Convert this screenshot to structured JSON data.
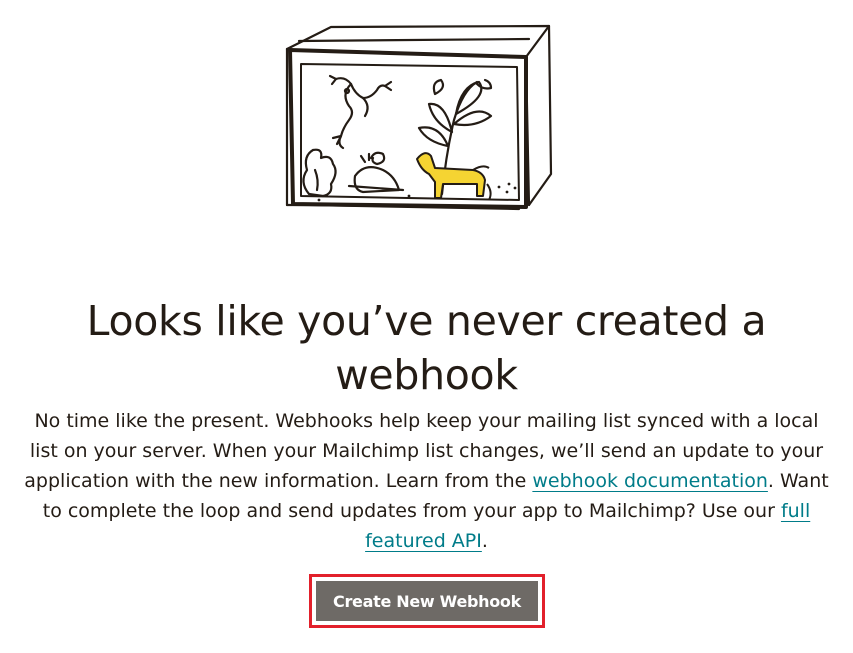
{
  "empty_state": {
    "illustration_icon": "terrarium-illustration",
    "headline": "Looks like you’ve never created a webhook",
    "body": {
      "text_1": "No time like the present. Webhooks help keep your mailing list synced with a local list on your server. When your Mailchimp list changes, we’ll send an update to your application with the new information. Learn from the ",
      "link_1": "webhook documentation",
      "text_2": ". Want to complete the loop and send updates from your app to Mailchimp? Use our ",
      "link_2": "full featured API",
      "text_3": "."
    },
    "cta_label": "Create New Webhook"
  },
  "colors": {
    "text": "#241c15",
    "link": "#007c89",
    "button": "#6e6a66",
    "highlight": "#e2202b",
    "accent_yellow": "#f5d432"
  }
}
